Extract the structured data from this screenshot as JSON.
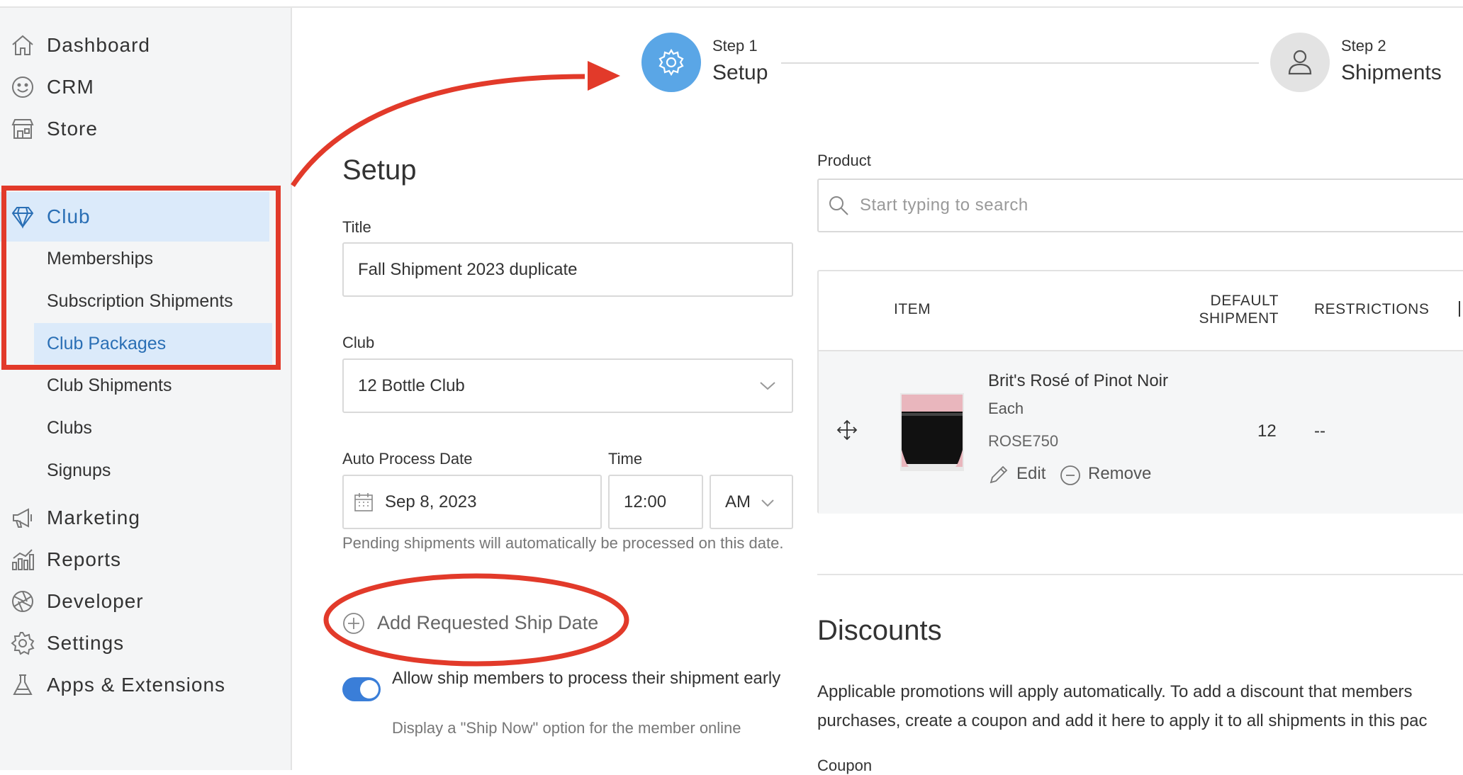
{
  "sidebar": {
    "items": [
      {
        "label": "Dashboard",
        "icon": "home-icon"
      },
      {
        "label": "CRM",
        "icon": "smiley-icon"
      },
      {
        "label": "Store",
        "icon": "storefront-icon"
      },
      {
        "label": "Club",
        "icon": "diamond-icon"
      },
      {
        "label": "Marketing",
        "icon": "megaphone-icon"
      },
      {
        "label": "Reports",
        "icon": "bar-chart-icon"
      },
      {
        "label": "Developer",
        "icon": "aperture-icon"
      },
      {
        "label": "Settings",
        "icon": "gear-icon"
      },
      {
        "label": "Apps & Extensions",
        "icon": "flask-icon"
      }
    ],
    "club_sub": [
      "Memberships",
      "Subscription Shipments",
      "Club Packages",
      "Club Shipments",
      "Clubs",
      "Signups"
    ]
  },
  "stepper": {
    "step1": {
      "small": "Step 1",
      "big": "Setup"
    },
    "step2": {
      "small": "Step 2",
      "big": "Shipments"
    }
  },
  "setup": {
    "heading": "Setup",
    "title_label": "Title",
    "title_value": "Fall Shipment 2023 duplicate",
    "club_label": "Club",
    "club_value": "12 Bottle Club",
    "date_label": "Auto Process Date",
    "date_value": "Sep 8, 2023",
    "time_label": "Time",
    "time_value": "12:00",
    "ampm_value": "AM",
    "date_hint": "Pending shipments will automatically be processed on this date.",
    "add_ship_date": "Add Requested Ship Date",
    "toggle_label": "Allow ship members to process their shipment early",
    "toggle_on": true,
    "toggle_sub": "Display a \"Ship Now\" option for the member online"
  },
  "product": {
    "label": "Product",
    "search_placeholder": "Start typing to search",
    "headers": {
      "item": "ITEM",
      "default_shipment_1": "DEFAULT",
      "default_shipment_2": "SHIPMENT",
      "restrictions": "RESTRICTIONS"
    },
    "row": {
      "name": "Brit's Rosé of Pinot Noir",
      "unit": "Each",
      "sku": "ROSE750",
      "edit": "Edit",
      "remove": "Remove",
      "default_shipment": "12",
      "restrictions": "--"
    }
  },
  "discounts": {
    "heading": "Discounts",
    "line1": "Applicable promotions will apply automatically. To add a discount that members",
    "line2": "purchases, create a coupon and add it here to apply it to all shipments in this pac",
    "coupon_label": "Coupon"
  },
  "colors": {
    "accent": "#2a6fb5",
    "step_active": "#5aa6e6",
    "annotation_red": "#e23a2a",
    "toggle": "#3a7ed8"
  }
}
